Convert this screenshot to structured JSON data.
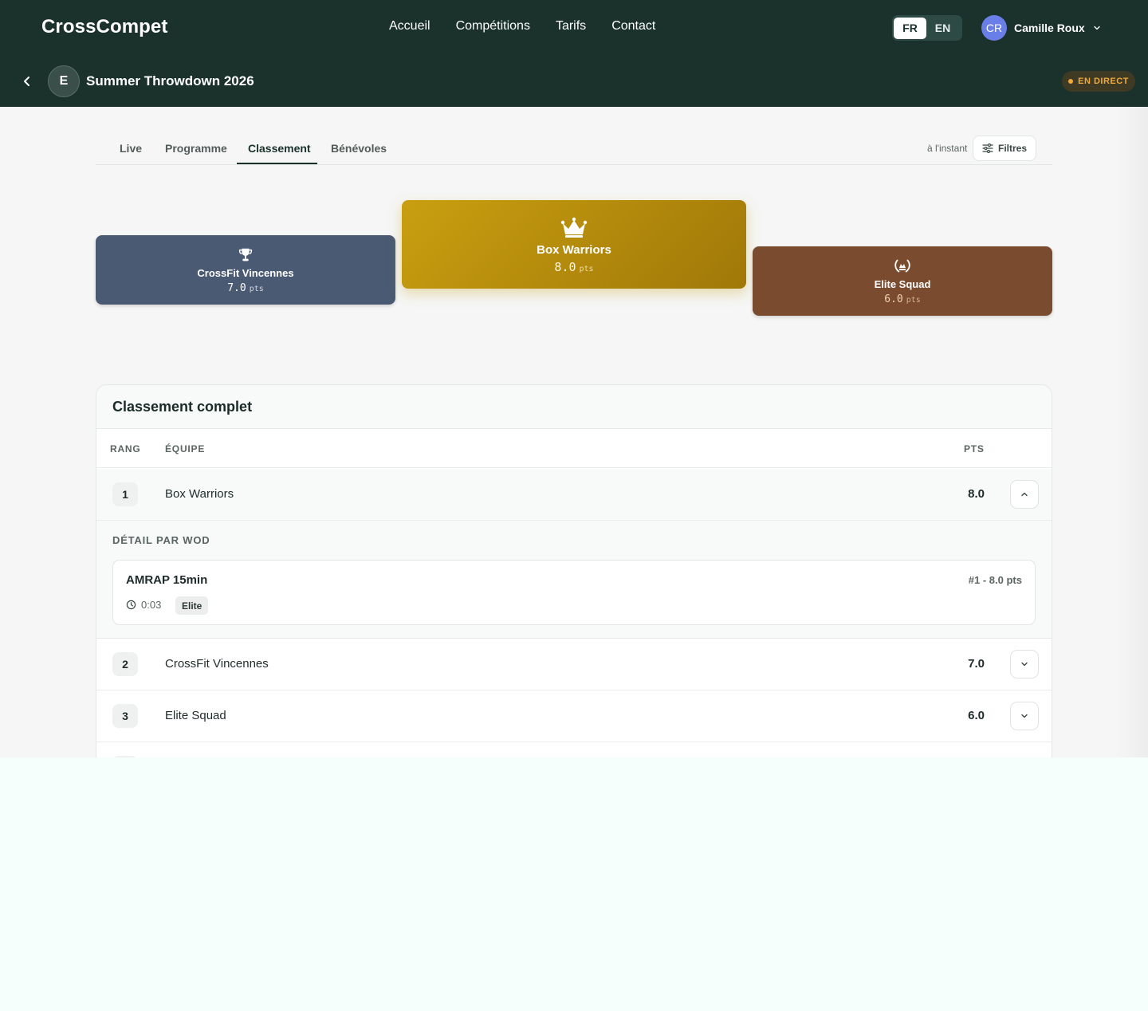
{
  "header": {
    "brand": "CrossCompet",
    "nav": [
      "Accueil",
      "Compétitions",
      "Tarifs",
      "Contact"
    ],
    "lang": {
      "options": [
        "FR",
        "EN"
      ],
      "active": "FR"
    },
    "user": {
      "initials": "CR",
      "name": "Camille Roux"
    }
  },
  "event": {
    "badge": "E",
    "title": "Summer Throwdown 2026",
    "status": "EN DIRECT",
    "status_color": "#f0a93a"
  },
  "tabs": {
    "items": [
      "Live",
      "Programme",
      "Classement",
      "Bénévoles"
    ],
    "active": "Classement",
    "updated": "à l'instant",
    "filters": "Filtres"
  },
  "podium": {
    "first": {
      "name": "Box Warriors",
      "pts": "8.0",
      "unit": "pts",
      "icon": "crown-icon",
      "color": "#c99f10"
    },
    "second": {
      "name": "CrossFit Vincennes",
      "pts": "7.0",
      "unit": "pts",
      "icon": "trophy-icon",
      "color": "#4a5a73"
    },
    "third": {
      "name": "Elite Squad",
      "pts": "6.0",
      "unit": "pts",
      "icon": "laurel-icon",
      "color": "#7a4b2e"
    }
  },
  "ranking": {
    "title": "Classement complet",
    "columns": {
      "rank": "RANG",
      "team": "ÉQUIPE",
      "pts": "PTS"
    },
    "rows": [
      {
        "rank": "1",
        "team": "Box Warriors",
        "pts": "8.0",
        "expanded": true
      },
      {
        "rank": "2",
        "team": "CrossFit Vincennes",
        "pts": "7.0",
        "expanded": false
      },
      {
        "rank": "3",
        "team": "Elite Squad",
        "pts": "6.0",
        "expanded": false
      }
    ],
    "detail": {
      "label": "DÉTAIL PAR WOD",
      "wod": {
        "name": "AMRAP 15min",
        "result": "#1 - 8.0 pts",
        "time": "0:03",
        "tag": "Elite"
      }
    }
  }
}
